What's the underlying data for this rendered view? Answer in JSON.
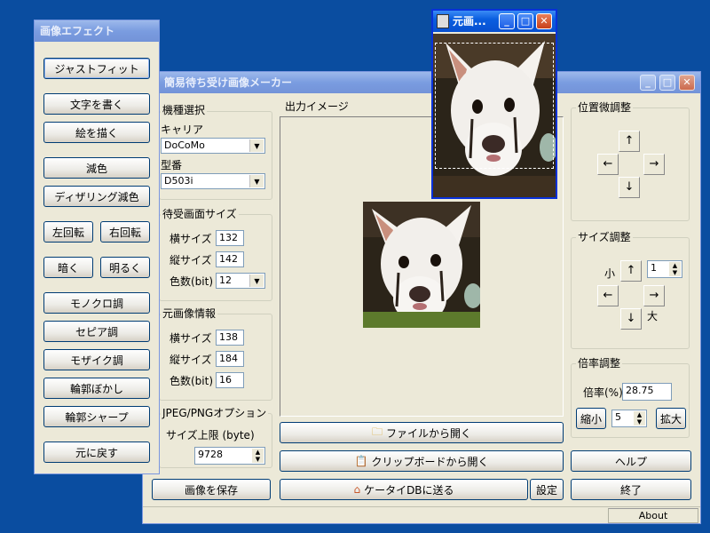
{
  "effects_window": {
    "title": "画像エフェクト",
    "buttons": {
      "just_fit": "ジャストフィット",
      "write_text": "文字を書く",
      "draw_picture": "絵を描く",
      "reduce_color": "減色",
      "dither_reduce": "ディザリング減色",
      "rotate_left": "左回転",
      "rotate_right": "右回転",
      "darker": "暗く",
      "brighter": "明るく",
      "monochrome": "モノクロ調",
      "sepia": "セピア調",
      "mosaic": "モザイク調",
      "blur_edges": "輪郭ぼかし",
      "sharpen_edges": "輪郭シャープ",
      "undo": "元に戻す"
    }
  },
  "main_window": {
    "title": "簡易待ち受け画像メーカー",
    "model_group": {
      "title": "機種選択",
      "carrier_label": "キャリア",
      "carrier_value": "DoCoMo",
      "model_label": "型番",
      "model_value": "D503i"
    },
    "standby_group": {
      "title": "待受画面サイズ",
      "width_label": "横サイズ",
      "width_value": "132",
      "height_label": "縦サイズ",
      "height_value": "142",
      "colors_label": "色数(bit)",
      "colors_value": "12"
    },
    "source_group": {
      "title": "元画像情報",
      "width_label": "横サイズ",
      "width_value": "138",
      "height_label": "縦サイズ",
      "height_value": "184",
      "colors_label": "色数(bit)",
      "colors_value": "16"
    },
    "jpeg_group": {
      "title": "JPEG/PNGオプション",
      "size_limit_label": "サイズ上限 (byte)",
      "size_limit_value": "9728"
    },
    "output_label": "出力イメージ",
    "position_group": {
      "title": "位置微調整",
      "up": "↑",
      "left": "←",
      "right": "→",
      "down": "↓"
    },
    "size_group": {
      "title": "サイズ調整",
      "small_label": "小",
      "large_label": "大",
      "step_value": "1",
      "up": "↑",
      "left": "←",
      "right": "→",
      "down": "↓"
    },
    "zoom_group": {
      "title": "倍率調整",
      "ratio_label": "倍率(%)",
      "ratio_value": "28.75",
      "shrink": "縮小",
      "step_value": "5",
      "enlarge": "拡大"
    },
    "buttons": {
      "open_file": "ファイルから開く",
      "open_clipboard": "クリップボードから開く",
      "save_image": "画像を保存",
      "send_phone": "ケータイDBに送る",
      "settings": "設定",
      "help": "ヘルプ",
      "exit": "終了"
    },
    "status": {
      "about": "About"
    }
  },
  "source_window": {
    "title": "元画..."
  },
  "colors": {
    "desktop": "#0a4da0",
    "titlebar": "#0a5ee0",
    "face": "#ece9d8"
  }
}
